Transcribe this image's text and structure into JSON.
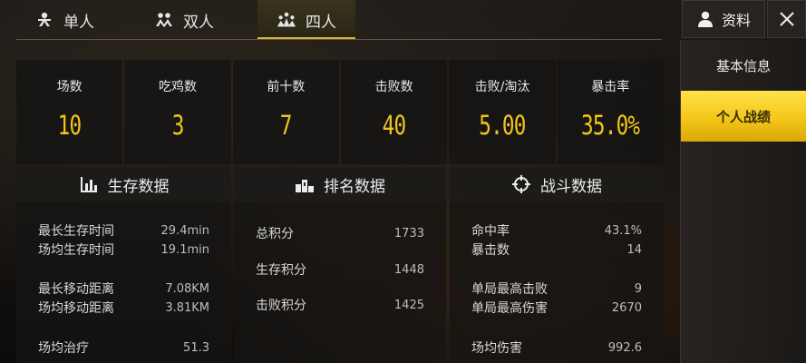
{
  "mode_tabs": [
    {
      "label": "单人",
      "icon": "single-person-icon"
    },
    {
      "label": "双人",
      "icon": "duo-icon"
    },
    {
      "label": "四人",
      "icon": "squad-icon",
      "active": true
    }
  ],
  "profile_button": {
    "label": "资料",
    "icon": "person-icon"
  },
  "close_button": {
    "icon": "close-icon"
  },
  "side_menu": [
    {
      "label": "基本信息"
    },
    {
      "label": "个人战绩",
      "active": true
    }
  ],
  "summary_stats": [
    {
      "label": "场数",
      "value": "10"
    },
    {
      "label": "吃鸡数",
      "value": "3"
    },
    {
      "label": "前十数",
      "value": "7"
    },
    {
      "label": "击败数",
      "value": "40"
    },
    {
      "label": "击败/淘汰",
      "value": "5.00"
    },
    {
      "label": "暴击率",
      "value": "35.0%"
    }
  ],
  "survival_panel": {
    "title": "生存数据",
    "icon": "bar-chart-icon",
    "rows": [
      {
        "label": "最长生存时间",
        "value": "29.4min"
      },
      {
        "label": "场均生存时间",
        "value": "19.1min"
      },
      {
        "label": "最长移动距离",
        "value": "7.08KM"
      },
      {
        "label": "场均移动距离",
        "value": "3.81KM"
      },
      {
        "label": "场均治疗",
        "value": "51.3"
      }
    ]
  },
  "ranking_panel": {
    "title": "排名数据",
    "icon": "podium-icon",
    "rows": [
      {
        "label": "总积分",
        "value": "1733"
      },
      {
        "label": "生存积分",
        "value": "1448"
      },
      {
        "label": "击败积分",
        "value": "1425"
      }
    ]
  },
  "combat_panel": {
    "title": "战斗数据",
    "icon": "crosshair-icon",
    "rows": [
      {
        "label": "命中率",
        "value": "43.1%"
      },
      {
        "label": "暴击数",
        "value": "14"
      },
      {
        "label": "单局最高击败",
        "value": "9"
      },
      {
        "label": "单局最高伤害",
        "value": "2670"
      },
      {
        "label": "场均伤害",
        "value": "992.6"
      }
    ]
  },
  "colors": {
    "accent": "#f3c518",
    "active_tab_underline": "#d8b92a",
    "active_menu": "#f2c315"
  }
}
